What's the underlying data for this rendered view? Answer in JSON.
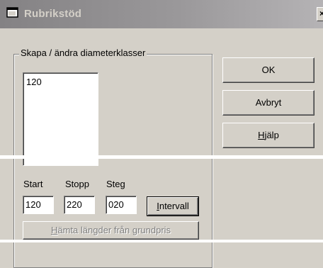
{
  "window": {
    "title": "Rubrikstöd",
    "close_glyph": "×"
  },
  "group": {
    "legend": "Skapa / ändra diameterklasser",
    "list_items": [
      "120"
    ]
  },
  "buttons": {
    "ok": "OK",
    "cancel": "Avbryt",
    "help_accel": "H",
    "help_rest": "jälp",
    "interval_accel": "I",
    "interval_rest": "ntervall",
    "fetch_accel": "H",
    "fetch_rest": "ämta längder från grundpris"
  },
  "range": {
    "start_label": "Start",
    "stop_label": "Stopp",
    "step_label": "Steg",
    "start_value": "120",
    "stop_value": "220",
    "step_value": "020"
  },
  "colors": {
    "face": "#d4d0c8",
    "title_gradient_start": "#848284",
    "title_gradient_end": "#b5b3b5",
    "disabled_text": "#808080"
  },
  "icons": [
    "window-icon"
  ]
}
